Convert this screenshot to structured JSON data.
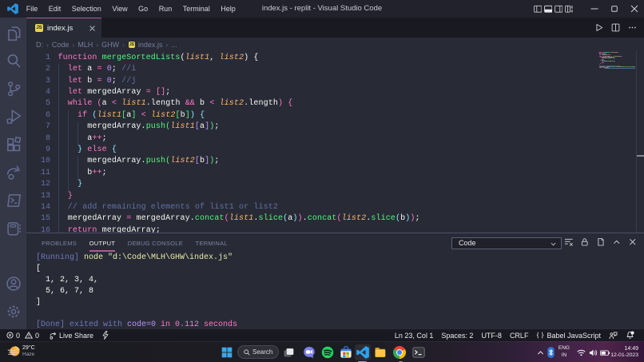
{
  "window": {
    "title": "index.js - replit - Visual Studio Code",
    "menus": [
      "File",
      "Edit",
      "Selection",
      "View",
      "Go",
      "Run",
      "Terminal",
      "Help"
    ]
  },
  "activity_bar": {
    "items": [
      "explorer",
      "search",
      "source-control",
      "run-and-debug",
      "extensions",
      "live-share",
      "code-runner",
      "remote-explorer"
    ],
    "bottom_items": [
      "account",
      "settings"
    ]
  },
  "editor": {
    "tab": {
      "label": "index.js",
      "icon": "JS"
    },
    "breadcrumbs": [
      "D:",
      "Code",
      "MLH",
      "GHW",
      "index.js",
      "..."
    ],
    "lines": [
      [
        [
          "k",
          "function"
        ],
        [
          "w",
          " "
        ],
        [
          "f",
          "mergeSortedLists"
        ],
        [
          "w",
          "("
        ],
        [
          "p",
          "list1"
        ],
        [
          "w",
          ", "
        ],
        [
          "p",
          "list2"
        ],
        [
          "w",
          ") {"
        ]
      ],
      [
        [
          "w",
          "  "
        ],
        [
          "k",
          "let"
        ],
        [
          "w",
          " a "
        ],
        [
          "k",
          "="
        ],
        [
          "w",
          " "
        ],
        [
          "n",
          "0"
        ],
        [
          "w",
          "; "
        ],
        [
          "c",
          "//i"
        ]
      ],
      [
        [
          "w",
          "  "
        ],
        [
          "k",
          "let"
        ],
        [
          "w",
          " b "
        ],
        [
          "k",
          "="
        ],
        [
          "w",
          " "
        ],
        [
          "n",
          "0"
        ],
        [
          "w",
          "; "
        ],
        [
          "c",
          "//j"
        ]
      ],
      [
        [
          "w",
          "  "
        ],
        [
          "k",
          "let"
        ],
        [
          "w",
          " mergedArray "
        ],
        [
          "k",
          "="
        ],
        [
          "w",
          " "
        ],
        [
          "k",
          "[]"
        ],
        [
          "w",
          ";"
        ]
      ],
      [
        [
          "w",
          "  "
        ],
        [
          "k",
          "while"
        ],
        [
          "w",
          " "
        ],
        [
          "k",
          "("
        ],
        [
          "w",
          "a "
        ],
        [
          "k",
          "<"
        ],
        [
          "w",
          " "
        ],
        [
          "p",
          "list1"
        ],
        [
          "w",
          ".length "
        ],
        [
          "k",
          "&&"
        ],
        [
          "w",
          " b "
        ],
        [
          "k",
          "<"
        ],
        [
          "w",
          " "
        ],
        [
          "p",
          "list2"
        ],
        [
          "w",
          ".length"
        ],
        [
          "k",
          ")"
        ],
        [
          "w",
          " "
        ],
        [
          "k",
          "{"
        ]
      ],
      [
        [
          "w",
          "    "
        ],
        [
          "k",
          "if"
        ],
        [
          "w",
          " "
        ],
        [
          "cy",
          "("
        ],
        [
          "p",
          "list1"
        ],
        [
          "f",
          "["
        ],
        [
          "w",
          "a"
        ],
        [
          "f",
          "]"
        ],
        [
          "w",
          " "
        ],
        [
          "k",
          "<"
        ],
        [
          "w",
          " "
        ],
        [
          "p",
          "list2"
        ],
        [
          "f",
          "["
        ],
        [
          "w",
          "b"
        ],
        [
          "f",
          "]"
        ],
        [
          "cy",
          ")"
        ],
        [
          "w",
          " "
        ],
        [
          "cy",
          "{"
        ]
      ],
      [
        [
          "w",
          "      mergedArray."
        ],
        [
          "f",
          "push"
        ],
        [
          "f",
          "("
        ],
        [
          "p",
          "list1"
        ],
        [
          "n",
          "["
        ],
        [
          "w",
          "a"
        ],
        [
          "n",
          "]"
        ],
        [
          "f",
          ")"
        ],
        [
          "w",
          ";"
        ]
      ],
      [
        [
          "w",
          "      a"
        ],
        [
          "k",
          "++"
        ],
        [
          "w",
          ";"
        ]
      ],
      [
        [
          "w",
          "    "
        ],
        [
          "cy",
          "}"
        ],
        [
          "w",
          " "
        ],
        [
          "k",
          "else"
        ],
        [
          "w",
          " "
        ],
        [
          "cy",
          "{"
        ]
      ],
      [
        [
          "w",
          "      mergedArray."
        ],
        [
          "f",
          "push"
        ],
        [
          "f",
          "("
        ],
        [
          "p",
          "list2"
        ],
        [
          "n",
          "["
        ],
        [
          "w",
          "b"
        ],
        [
          "n",
          "]"
        ],
        [
          "f",
          ")"
        ],
        [
          "w",
          ";"
        ]
      ],
      [
        [
          "w",
          "      b"
        ],
        [
          "k",
          "++"
        ],
        [
          "w",
          ";"
        ]
      ],
      [
        [
          "w",
          "    "
        ],
        [
          "cy",
          "}"
        ]
      ],
      [
        [
          "w",
          "  "
        ],
        [
          "k",
          "}"
        ]
      ],
      [
        [
          "w",
          "  "
        ],
        [
          "c",
          "// add remaining elements of list1 or list2"
        ]
      ],
      [
        [
          "w",
          "  mergedArray "
        ],
        [
          "k",
          "="
        ],
        [
          "w",
          " mergedArray."
        ],
        [
          "f",
          "concat"
        ],
        [
          "k",
          "("
        ],
        [
          "p",
          "list1"
        ],
        [
          "w",
          "."
        ],
        [
          "f",
          "slice"
        ],
        [
          "cy",
          "("
        ],
        [
          "w",
          "a"
        ],
        [
          "cy",
          ")"
        ],
        [
          "k",
          ")"
        ],
        [
          "w",
          "."
        ],
        [
          "f",
          "concat"
        ],
        [
          "k",
          "("
        ],
        [
          "p",
          "list2"
        ],
        [
          "w",
          "."
        ],
        [
          "f",
          "slice"
        ],
        [
          "cy",
          "("
        ],
        [
          "w",
          "b"
        ],
        [
          "cy",
          ")"
        ],
        [
          "k",
          ")"
        ],
        [
          "w",
          ";"
        ]
      ],
      [
        [
          "w",
          "  "
        ],
        [
          "k",
          "return"
        ],
        [
          "w",
          " mergedArray;"
        ]
      ]
    ]
  },
  "panel": {
    "tabs": [
      {
        "label": "PROBLEMS",
        "active": false
      },
      {
        "label": "OUTPUT",
        "active": true
      },
      {
        "label": "DEBUG CONSOLE",
        "active": false
      },
      {
        "label": "TERMINAL",
        "active": false
      }
    ],
    "channel": "Code",
    "output_lines": [
      [
        [
          "b",
          "[Running] "
        ],
        [
          "y",
          "node \"d:\\Code\\MLH\\GHW\\index.js\""
        ]
      ],
      [
        [
          "w",
          "["
        ]
      ],
      [
        [
          "w",
          "  1, 2, 3, 4,"
        ]
      ],
      [
        [
          "w",
          "  5, 6, 7, 8"
        ]
      ],
      [
        [
          "w",
          "]"
        ]
      ],
      [],
      [
        [
          "b",
          "[Done] exited with "
        ],
        [
          "m",
          "code=0"
        ],
        [
          "pk",
          " in 0.112 seconds"
        ]
      ]
    ]
  },
  "status_bar": {
    "errors": "0",
    "warnings": "0",
    "live_share": "Live Share",
    "cursor": "Ln 23, Col 1",
    "indentation": "Spaces: 2",
    "encoding": "UTF-8",
    "eol": "CRLF",
    "language": "Babel JavaScript"
  },
  "taskbar": {
    "weather": {
      "temp": "29°C",
      "condition": "Haze"
    },
    "search_label": "Search",
    "apps": [
      "start",
      "search",
      "task-view",
      "chat",
      "spotify",
      "store",
      "vscode",
      "file-explorer",
      "chrome",
      "terminal"
    ],
    "tray": {
      "lang_line1": "ENG",
      "lang_line2": "IN",
      "time": "14:49",
      "date": "12-01-2023"
    }
  },
  "colors": {
    "editor_bg": "#282a36",
    "titlebar_bg": "#21222c",
    "activitybar_bg": "#343746",
    "tabstrip_bg": "#191a21",
    "statusbar_bg": "#191a21",
    "keyword": "#ff79c6",
    "function": "#50fa7b",
    "parameter": "#ffb86c",
    "number": "#bd93f9",
    "comment": "#6272a4",
    "foreground": "#f8f8f2",
    "accent_pink": "#b45c9c",
    "taskbar_accent": "#41c8d6"
  }
}
